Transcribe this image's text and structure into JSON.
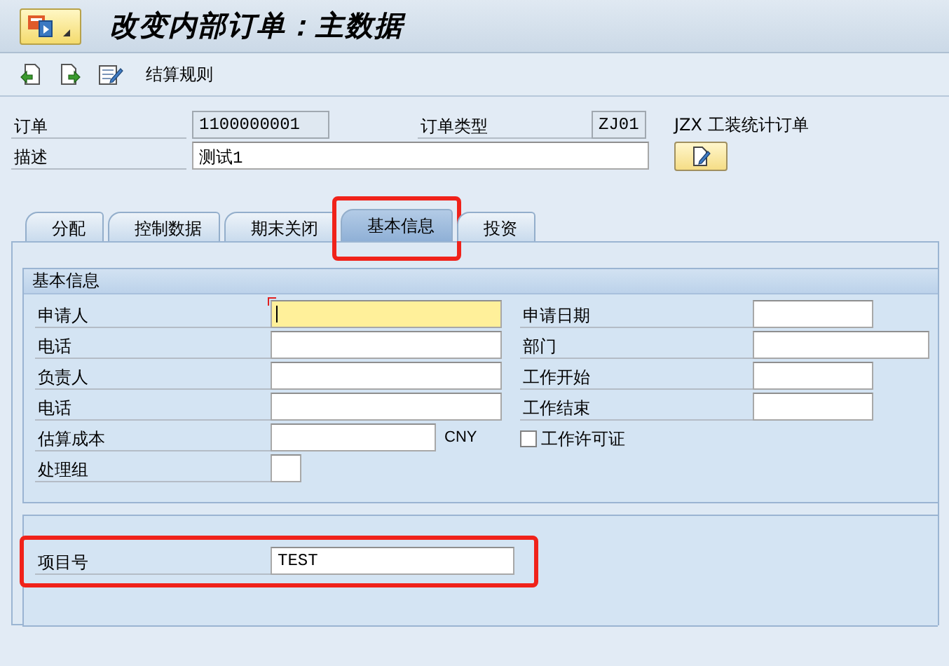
{
  "window": {
    "title": "改变内部订单：主数据"
  },
  "toolbar": {
    "button": "结算规则"
  },
  "header": {
    "order": {
      "label": "订单",
      "value": "1100000001"
    },
    "order_type": {
      "label": "订单类型",
      "value": "ZJ01",
      "text": "JZX 工装统计订单"
    },
    "description": {
      "label": "描述",
      "value": "测试1"
    }
  },
  "tabs": [
    {
      "label": "分配",
      "selected": false,
      "highlighted": false
    },
    {
      "label": "控制数据",
      "selected": false,
      "highlighted": false
    },
    {
      "label": "期末关闭",
      "selected": false,
      "highlighted": false
    },
    {
      "label": "基本信息",
      "selected": true,
      "highlighted": true
    },
    {
      "label": "投资",
      "selected": false,
      "highlighted": false
    }
  ],
  "basic_info": {
    "title": "基本信息",
    "left_fields": [
      {
        "label": "申请人",
        "kind": "text",
        "focused": true
      },
      {
        "label": "电话",
        "kind": "text",
        "focused": false
      },
      {
        "label": "负责人",
        "kind": "text",
        "focused": false
      },
      {
        "label": "电话",
        "kind": "text",
        "focused": false
      },
      {
        "label": "估算成本",
        "kind": "amount",
        "currency": "CNY",
        "focused": false
      },
      {
        "label": "处理组",
        "kind": "code",
        "focused": false
      }
    ],
    "right_fields": [
      {
        "label": "申请日期",
        "kind": "date"
      },
      {
        "label": "部门",
        "kind": "text"
      },
      {
        "label": "工作开始",
        "kind": "date"
      },
      {
        "label": "工作结束",
        "kind": "date"
      },
      {
        "label": "工作许可证",
        "kind": "checkbox",
        "checked": false
      }
    ]
  },
  "project": {
    "fields": [
      {
        "label": "项目号",
        "value": "TEST",
        "highlighted": true
      }
    ]
  }
}
